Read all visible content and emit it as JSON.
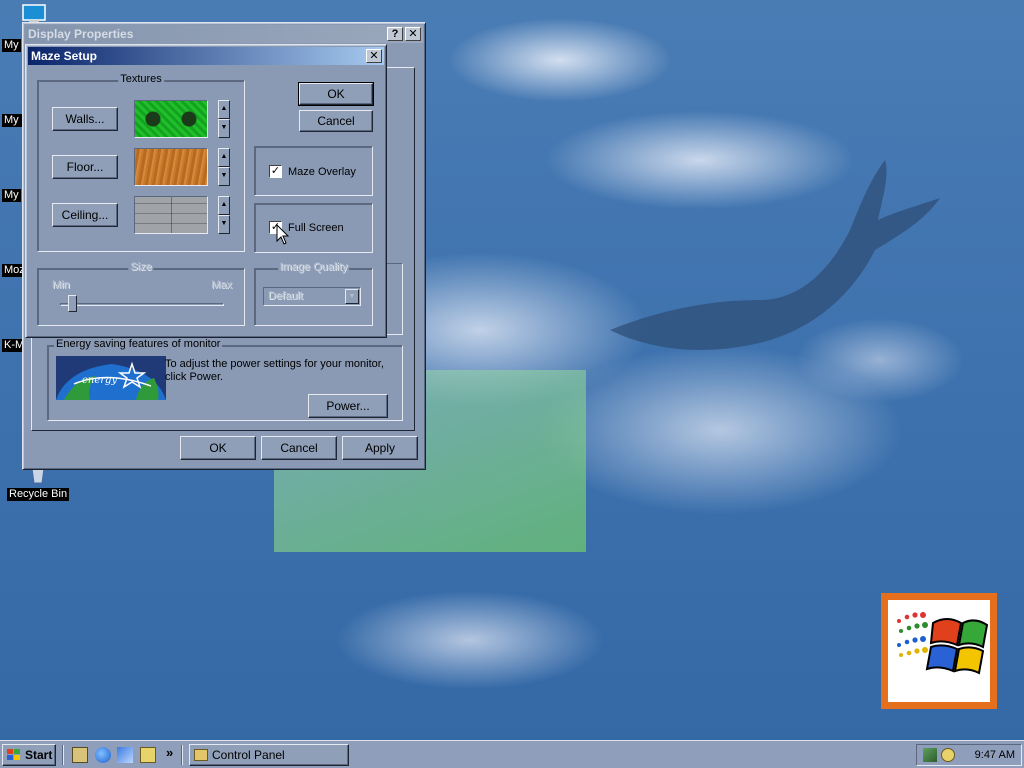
{
  "desktop": {
    "icons": [
      {
        "label": "My"
      },
      {
        "label": "My D"
      },
      {
        "label": "My"
      },
      {
        "label": "Moz"
      },
      {
        "label": "K-M"
      },
      {
        "label": "Recycle Bin"
      }
    ]
  },
  "display_properties": {
    "title": "Display Properties",
    "help_button": "?",
    "close_button": "✕",
    "energy": {
      "legend": "Energy saving features of monitor",
      "logo_text": "energy",
      "text": "To adjust the power settings for your monitor, click Power.",
      "power_button": "Power..."
    },
    "ok_button": "OK",
    "cancel_button": "Cancel",
    "apply_button": "Apply"
  },
  "maze_setup": {
    "title": "Maze Setup",
    "close_button": "✕",
    "textures": {
      "legend": "Textures",
      "walls_button": "Walls...",
      "floor_button": "Floor...",
      "ceiling_button": "Ceiling..."
    },
    "ok_button": "OK",
    "cancel_button": "Cancel",
    "maze_overlay": {
      "label": "Maze Overlay",
      "checked": true
    },
    "full_screen": {
      "label": "Full Screen",
      "checked": true
    },
    "size": {
      "legend": "Size",
      "min_label": "Min",
      "max_label": "Max",
      "value": 0.05
    },
    "image_quality": {
      "legend": "Image Quality",
      "selected": "Default"
    }
  },
  "taskbar": {
    "start_label": "Start",
    "tasks": [
      {
        "label": "Control Panel"
      }
    ],
    "quicklaunch_more": "»",
    "clock": "9:47 AM"
  },
  "colors": {
    "title_active": "#0a246a",
    "title_gradient_end": "#a6caf0",
    "window_face": "#8a9ab4",
    "taskbar": "#8e9ebb"
  }
}
